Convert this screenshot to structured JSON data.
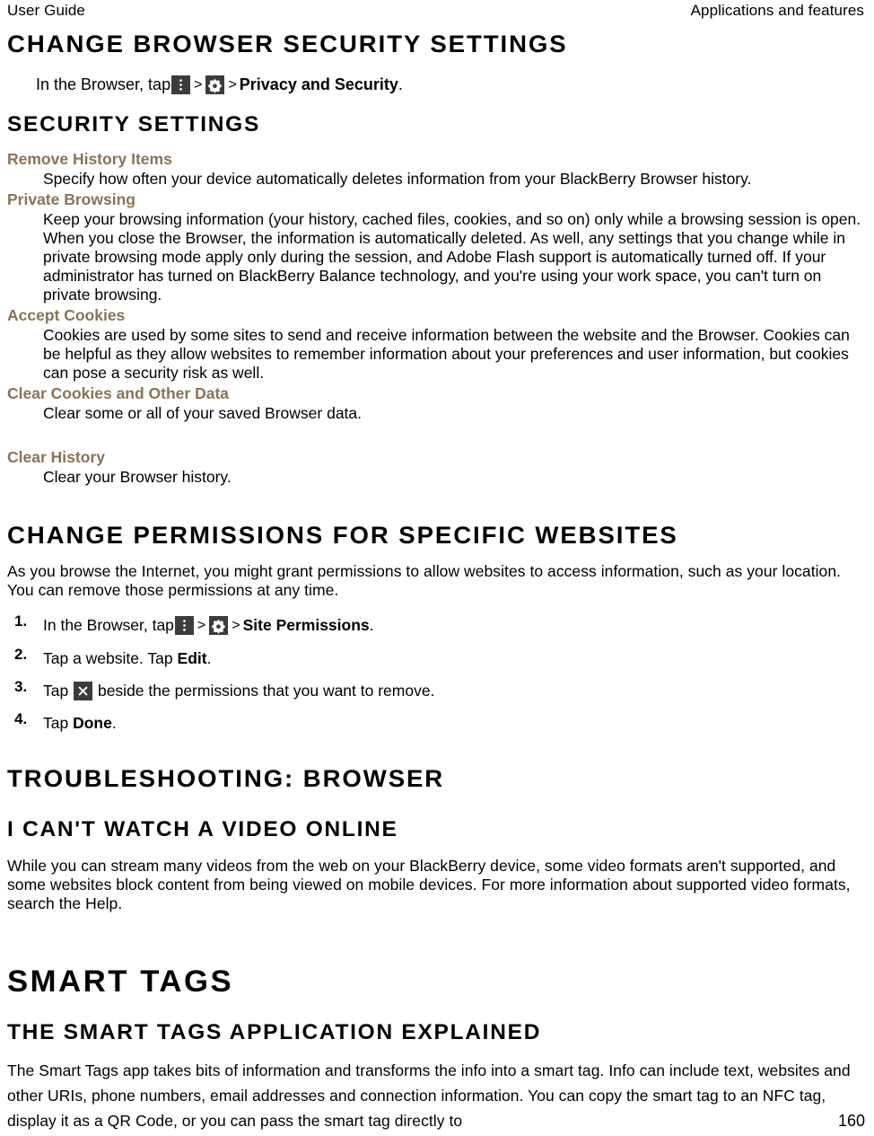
{
  "header": {
    "left": "User Guide",
    "right": "Applications and features"
  },
  "sections": {
    "change_browser_security": {
      "heading": "Change browser security settings",
      "step_prefix": "In the Browser, tap",
      "sep": ">",
      "step_bold": "Privacy and Security",
      "step_suffix": "."
    },
    "security_settings": {
      "heading": "Security settings",
      "terms": [
        {
          "term": "Remove History Items",
          "def": "Specify how often your device automatically deletes information from your BlackBerry Browser history."
        },
        {
          "term": "Private Browsing",
          "def": "Keep your browsing information (your history, cached files, cookies, and so on) only while a browsing session is open. When you close the Browser, the information is automatically deleted. As well, any settings that you change while in private browsing mode apply only during the session, and Adobe Flash support is automatically turned off. If your administrator has turned on BlackBerry Balance technology, and you're using your work space, you can't turn on private browsing."
        },
        {
          "term": "Accept Cookies",
          "def": "Cookies are used by some sites to send and receive information between the website and the Browser. Cookies can be helpful as they allow websites to remember information about your preferences and user information, but cookies can pose a security risk as well."
        },
        {
          "term": "Clear Cookies and Other Data",
          "def": "Clear some or all of your saved Browser data."
        },
        {
          "term": "Clear History",
          "def": "Clear your Browser history."
        }
      ]
    },
    "change_permissions": {
      "heading": "Change permissions for specific websites",
      "intro": "As you browse the Internet, you might grant permissions to allow websites to access information, such as your location. You can remove those permissions at any time.",
      "steps": [
        {
          "num": "1.",
          "text_before": "In the Browser, tap",
          "sep": ">",
          "bold": "Site Permissions",
          "text_after": "."
        },
        {
          "num": "2.",
          "text_before": "Tap a website. Tap",
          "bold": "Edit",
          "text_after": "."
        },
        {
          "num": "3.",
          "text_before": "Tap",
          "text_after": "beside the permissions that you want to remove."
        },
        {
          "num": "4.",
          "text_before": "Tap",
          "bold": "Done",
          "text_after": "."
        }
      ]
    },
    "troubleshooting": {
      "heading": "Troubleshooting: Browser",
      "sub_heading": "I can't watch a video online",
      "body": "While you can stream many videos from the web on your BlackBerry device, some video formats aren't supported, and some websites block content from being viewed on mobile devices. For more information about supported video formats, search the Help."
    },
    "smart_tags": {
      "heading": "Smart Tags",
      "sub_heading": "The Smart Tags application explained",
      "body": "The Smart Tags app takes bits of information and transforms the info into a smart tag. Info can include text, websites and other URIs, phone numbers, email addresses and connection information. You can copy the smart tag to an NFC tag, display it as a QR Code, or you can pass the smart tag directly to"
    }
  },
  "icons": {
    "overflow_menu": "overflow-menu-icon",
    "settings_gear": "gear-icon",
    "remove": "close-x-icon"
  },
  "colors": {
    "term_brown": "#8a7355",
    "chip_background": "#3c3c3c",
    "text": "#000000",
    "page_background": "#ffffff"
  },
  "folio": "160"
}
